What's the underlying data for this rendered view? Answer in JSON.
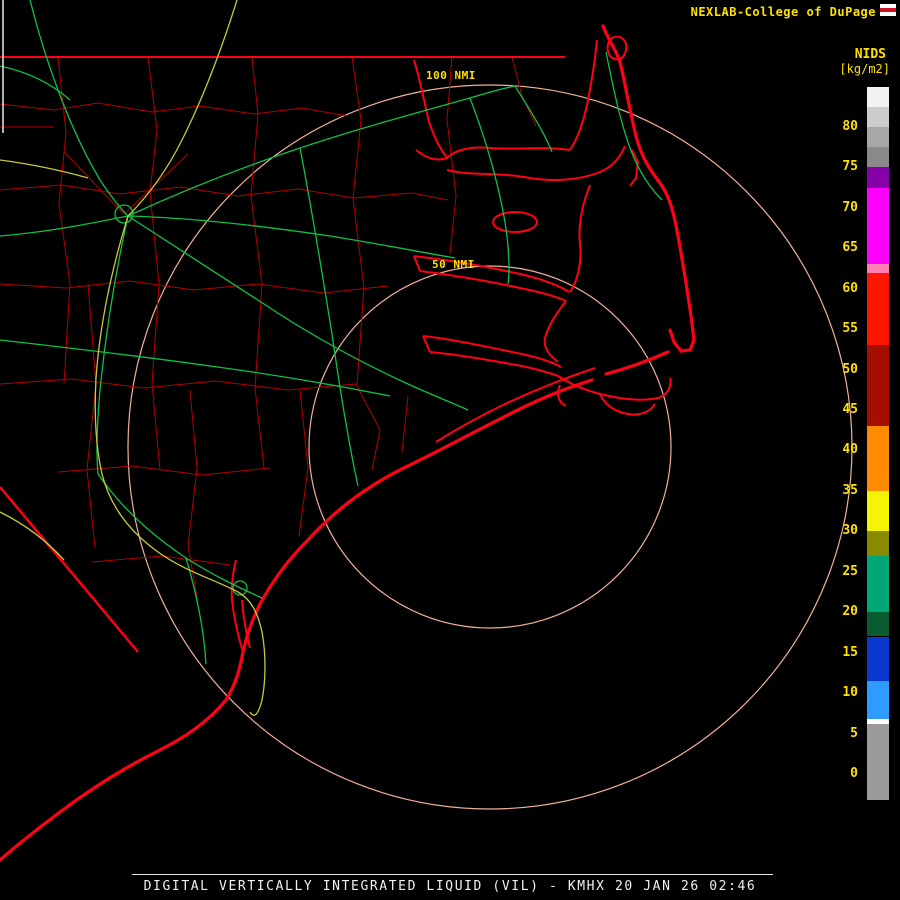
{
  "header": {
    "brand": "NEXLAB-College of DuPage",
    "nids": "NIDS",
    "units": "[kg/m2]"
  },
  "range_rings": {
    "outer_label": "100 NMI",
    "inner_label": "50 NMI"
  },
  "footer": {
    "title": "DIGITAL VERTICALLY INTEGRATED LIQUID (VIL) - KMHX 20 JAN 26 02:46"
  },
  "colors": {
    "label_yellow": "#ffe100",
    "coast_red": "#ff0016",
    "county_red": "#b40000",
    "road_green": "#0fc04a",
    "road_yellow": "#c8c83c",
    "ring_salmon": "#f2b099",
    "footer_white": "#f0f0f0"
  },
  "colorbar": {
    "unit": "kg/m2",
    "ticks": [
      80,
      75,
      70,
      65,
      60,
      55,
      50,
      45,
      40,
      35,
      30,
      25,
      20,
      15,
      10,
      5,
      0
    ],
    "segments": [
      {
        "from": -3.2,
        "to": 6.2,
        "color": "#9b9b9b"
      },
      {
        "from": 6.2,
        "to": 6.8,
        "color": "#ffffff"
      },
      {
        "from": 6.8,
        "to": 11.5,
        "color": "#2e9bff"
      },
      {
        "from": 11.5,
        "to": 17,
        "color": "#0b38cc"
      },
      {
        "from": 17,
        "to": 20,
        "color": "#0a5c30"
      },
      {
        "from": 20,
        "to": 27,
        "color": "#00a876"
      },
      {
        "from": 27,
        "to": 30,
        "color": "#8a8a00"
      },
      {
        "from": 30,
        "to": 35,
        "color": "#f5f500"
      },
      {
        "from": 35,
        "to": 43,
        "color": "#ff8c00"
      },
      {
        "from": 43,
        "to": 53,
        "color": "#a50f00"
      },
      {
        "from": 53,
        "to": 62,
        "color": "#ff1500"
      },
      {
        "from": 62,
        "to": 63,
        "color": "#ff7eb4"
      },
      {
        "from": 63,
        "to": 72.5,
        "color": "#ff00ff"
      },
      {
        "from": 72.5,
        "to": 75,
        "color": "#8800aa"
      },
      {
        "from": 75,
        "to": 77.5,
        "color": "#8a8a8a"
      },
      {
        "from": 77.5,
        "to": 80,
        "color": "#a8a8a8"
      },
      {
        "from": 80,
        "to": 82.5,
        "color": "#cccccc"
      },
      {
        "from": 82.5,
        "to": 85,
        "color": "#f2f2f2"
      }
    ]
  }
}
